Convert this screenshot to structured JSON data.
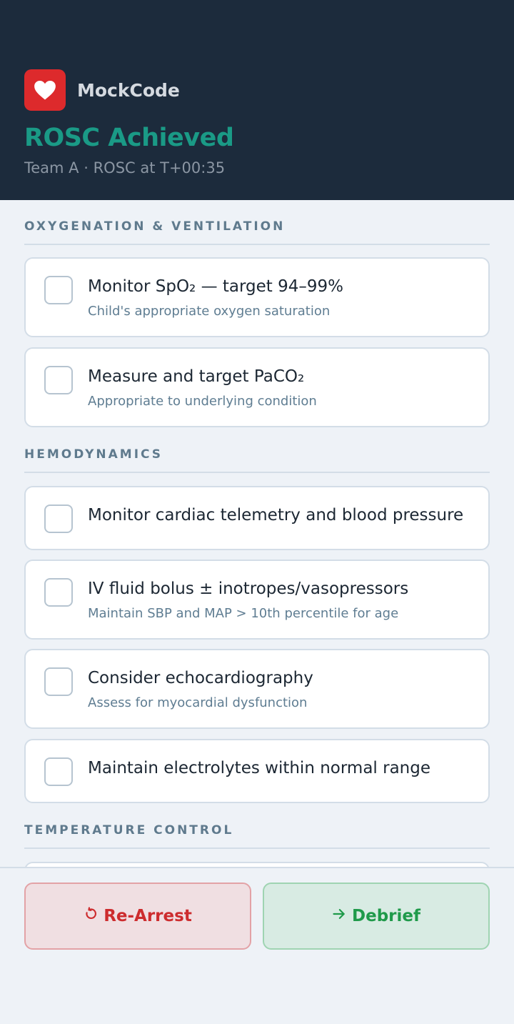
{
  "header": {
    "app_name": "MockCode",
    "status_title": "ROSC Achieved",
    "status_sub": "Team A · ROSC at T+00:35",
    "logo_icon": "heart-icon"
  },
  "colors": {
    "header_bg": "#1c2b3c",
    "accent_teal": "#1a9a86",
    "logo_red": "#dd2a2c",
    "danger": "#cd2c2e",
    "success": "#1f9a4a"
  },
  "sections": [
    {
      "title": "OXYGENATION & VENTILATION",
      "items": [
        {
          "title": "Monitor SpO₂ — target 94–99%",
          "sub": "Child's appropriate oxygen saturation",
          "checked": false
        },
        {
          "title": "Measure and target PaCO₂",
          "sub": "Appropriate to underlying condition",
          "checked": false
        }
      ]
    },
    {
      "title": "HEMODYNAMICS",
      "items": [
        {
          "title": "Monitor cardiac telemetry and blood pressure",
          "sub": "",
          "checked": false
        },
        {
          "title": "IV fluid bolus ± inotropes/vasopressors",
          "sub": "Maintain SBP and MAP > 10th percentile for age",
          "checked": false
        },
        {
          "title": "Consider echocardiography",
          "sub": "Assess for myocardial dysfunction",
          "checked": false
        },
        {
          "title": "Maintain electrolytes within normal range",
          "sub": "",
          "checked": false
        }
      ]
    },
    {
      "title": "TEMPERATURE CONTROL",
      "items": []
    }
  ],
  "footer": {
    "rearrest_label": "Re-Arrest",
    "rearrest_icon": "restart-icon",
    "debrief_label": "Debrief",
    "debrief_icon": "arrow-right-icon"
  }
}
